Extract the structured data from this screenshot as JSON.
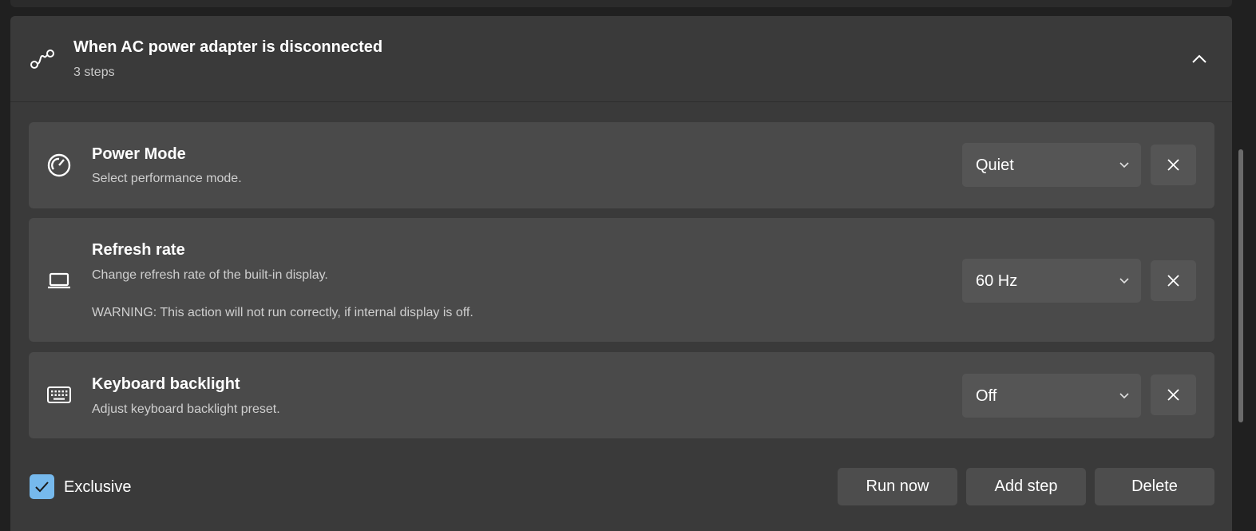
{
  "automation": {
    "title": "When AC power adapter is disconnected",
    "subtitle": "3 steps",
    "trigger_icon": "flow-path-icon",
    "collapse_icon": "chevron-up-icon"
  },
  "steps": [
    {
      "icon": "gauge-icon",
      "title": "Power Mode",
      "description": "Select performance mode.",
      "value": "Quiet"
    },
    {
      "icon": "laptop-icon",
      "title": "Refresh rate",
      "description": "Change refresh rate of the built-in display.",
      "warning": "WARNING: This action will not run correctly, if internal display is off.",
      "value": "60 Hz"
    },
    {
      "icon": "keyboard-icon",
      "title": "Keyboard backlight",
      "description": "Adjust keyboard backlight preset.",
      "value": "Off"
    }
  ],
  "footer": {
    "exclusive_label": "Exclusive",
    "exclusive_checked": true,
    "run_now_label": "Run now",
    "add_step_label": "Add step",
    "delete_label": "Delete"
  },
  "colors": {
    "accent": "#76b9ed",
    "card": "#4a4a4a",
    "expander": "#3a3a3a",
    "background": "#202020"
  }
}
